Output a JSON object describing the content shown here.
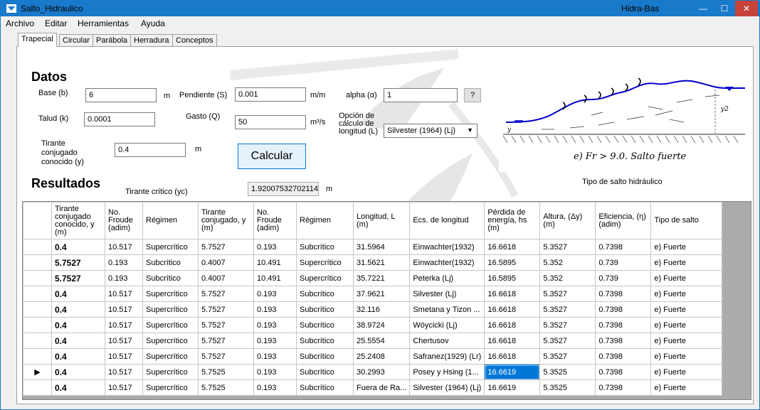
{
  "window": {
    "title": "Salto_Hidraulico",
    "right_title": "Hidra-Bas",
    "controls": {
      "minimize": "—",
      "maximize": "☐",
      "close": "✕"
    }
  },
  "menu": [
    "Archivo",
    "Editar",
    "Herramientas",
    "Ayuda"
  ],
  "tabs": [
    "Trapecial",
    "Circular",
    "Parábola",
    "Herradura",
    "Conceptos"
  ],
  "active_tab": "Trapecial",
  "datos": {
    "heading": "Datos",
    "base_label": "Base (b)",
    "base_value": "6",
    "base_unit": "m",
    "pendiente_label": "Pendiente (S)",
    "pendiente_value": "0.001",
    "pendiente_unit": "m/m",
    "alpha_label": "alpha (α)",
    "alpha_value": "1",
    "help_button": "?",
    "talud_label": "Talud (k)",
    "talud_value": "0.0001",
    "gasto_label": "Gasto (Q)",
    "gasto_value": "50",
    "gasto_unit": "m³/s",
    "opcion_label": "Opción de cálculo de longitud (L)",
    "opcion_value": "Silvester (1964) (Lj)",
    "tirante_label": "Tirante conjugado conocido (y)",
    "tirante_value": "0.4",
    "tirante_unit": "m",
    "calcular_button": "Calcular"
  },
  "resultados": {
    "heading": "Resultados",
    "critico_label": "Tirante crítico (yc)",
    "critico_value": "1.92007532702114",
    "critico_unit": "m"
  },
  "diagram": {
    "formula": "e) Fr > 9.0. Salto fuerte",
    "caption": "Tipo de salto hidráulico",
    "y1": "y",
    "y2": "y2"
  },
  "table": {
    "headers": [
      "Tirante conjugado conocido, y (m)",
      "No. Froude (adim)",
      "Régimen",
      "Tirante conjugado, y (m)",
      "No. Froude (adim)",
      "Régimen",
      "Longitud, L (m)",
      "Ecs. de longitud",
      "Pérdida de energía, hs (m)",
      "Altura, (Δy) (m)",
      "Eficiencia, (η) (adim)",
      "Tipo de salto"
    ],
    "rows": [
      [
        "0.4",
        "10.517",
        "Supercrítico",
        "5.7527",
        "0.193",
        "Subcrítico",
        "31.5964",
        "Einwachter(1932)",
        "16.6618",
        "5.3527",
        "0.7398",
        "e) Fuerte"
      ],
      [
        "5.7527",
        "0.193",
        "Subcrítico",
        "0.4007",
        "10.491",
        "Supercrítico",
        "31.5621",
        "Einwachter(1932)",
        "16.5895",
        "5.352",
        "0.739",
        "e) Fuerte"
      ],
      [
        "5.7527",
        "0.193",
        "Subcrítico",
        "0.4007",
        "10.491",
        "Supercrítico",
        "35.7221",
        "Peterka (Lj)",
        "16.5895",
        "5.352",
        "0.739",
        "e) Fuerte"
      ],
      [
        "0.4",
        "10.517",
        "Supercrítico",
        "5.7527",
        "0.193",
        "Subcrítico",
        "37.9621",
        "Silvester (Lj)",
        "16.6618",
        "5.3527",
        "0.7398",
        "e) Fuerte"
      ],
      [
        "0.4",
        "10.517",
        "Supercrítico",
        "5.7527",
        "0.193",
        "Subcrítico",
        "32.116",
        "Smetana y Tizon ...",
        "16.6618",
        "5.3527",
        "0.7398",
        "e) Fuerte"
      ],
      [
        "0.4",
        "10.517",
        "Supercrítico",
        "5.7527",
        "0.193",
        "Subcrítico",
        "38.9724",
        "Wóycicki (Lj)",
        "16.6618",
        "5.3527",
        "0.7398",
        "e) Fuerte"
      ],
      [
        "0.4",
        "10.517",
        "Supercrítico",
        "5.7527",
        "0.193",
        "Subcrítico",
        "25.5554",
        "Chertusov",
        "16.6618",
        "5.3527",
        "0.7398",
        "e) Fuerte"
      ],
      [
        "0.4",
        "10.517",
        "Supercrítico",
        "5.7527",
        "0.193",
        "Subcrítico",
        "25.2408",
        "Safranez(1929) (Lr)",
        "16.6618",
        "5.3527",
        "0.7398",
        "e) Fuerte"
      ],
      [
        "0.4",
        "10.517",
        "Supercrítico",
        "5.7525",
        "0.193",
        "Subcrítico",
        "30.2993",
        "Posey y Hsing (1...",
        "16.6619",
        "5.3525",
        "0.7398",
        "e) Fuerte"
      ],
      [
        "0.4",
        "10.517",
        "Supercrítico",
        "5.7525",
        "0.193",
        "Subcrítico",
        "Fuera de Ra...",
        "Silvester (1964) (Lj)",
        "16.6619",
        "5.3525",
        "0.7398",
        "e) Fuerte"
      ]
    ],
    "current_row_marker": "▶",
    "current_row": 8,
    "selected_col": 8
  },
  "colors": {
    "titlebar": "#1979ca",
    "close": "#c7433a",
    "selection": "#0078d7",
    "wave": "#0000cc"
  }
}
